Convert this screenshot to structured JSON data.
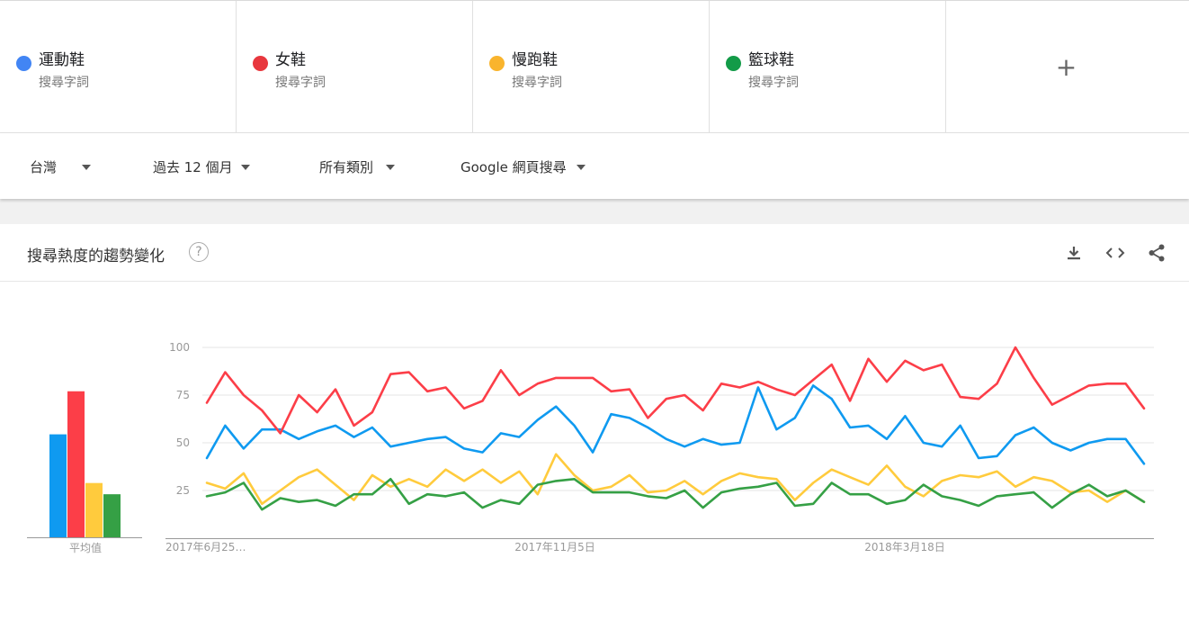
{
  "terms": [
    {
      "name": "運動鞋",
      "sub": "搜尋字詞",
      "color": "#4285f4"
    },
    {
      "name": "女鞋",
      "sub": "搜尋字詞",
      "color": "#e8373e"
    },
    {
      "name": "慢跑鞋",
      "sub": "搜尋字詞",
      "color": "#f9b42d"
    },
    {
      "name": "籃球鞋",
      "sub": "搜尋字詞",
      "color": "#139b48"
    }
  ],
  "add_label": "+",
  "filters": {
    "region": "台灣",
    "time": "過去 12 個月",
    "category": "所有類別",
    "search_type": "Google 網頁搜尋"
  },
  "card": {
    "title": "搜尋熱度的趨勢變化",
    "help": "?"
  },
  "chart_data": [
    {
      "type": "bar",
      "categories": [
        "運動鞋",
        "女鞋",
        "慢跑鞋",
        "籃球鞋"
      ],
      "values": [
        55,
        78,
        29,
        23
      ],
      "colors": [
        "#0f9af0",
        "#fc3e48",
        "#ffcb3d",
        "#35a045"
      ],
      "xlabel": "平均值",
      "ylim": [
        0,
        100
      ]
    },
    {
      "type": "line",
      "x_tick_labels": [
        "2017年6月25…",
        "2017年11月5日",
        "2018年3月18日"
      ],
      "y_ticks": [
        25,
        50,
        75,
        100
      ],
      "ylim": [
        0,
        100
      ],
      "grid": true,
      "series": [
        {
          "name": "運動鞋",
          "color": "#0f9af0",
          "values": [
            42,
            59,
            47,
            57,
            57,
            52,
            56,
            59,
            53,
            58,
            48,
            50,
            52,
            53,
            47,
            45,
            55,
            53,
            62,
            69,
            59,
            45,
            65,
            63,
            58,
            52,
            48,
            52,
            49,
            50,
            79,
            57,
            63,
            80,
            73,
            58,
            59,
            52,
            64,
            50,
            48,
            59,
            42,
            43,
            54,
            58,
            50,
            46,
            50,
            52,
            52,
            39
          ]
        },
        {
          "name": "女鞋",
          "color": "#fc3e48",
          "values": [
            71,
            87,
            75,
            67,
            55,
            75,
            66,
            78,
            59,
            66,
            86,
            87,
            77,
            79,
            68,
            72,
            88,
            75,
            81,
            84,
            84,
            84,
            77,
            78,
            63,
            73,
            75,
            67,
            81,
            79,
            82,
            78,
            75,
            83,
            91,
            72,
            94,
            82,
            93,
            88,
            91,
            74,
            73,
            81,
            100,
            84,
            70,
            75,
            80,
            81,
            81,
            68
          ]
        },
        {
          "name": "慢跑鞋",
          "color": "#ffcb3d",
          "values": [
            29,
            26,
            34,
            18,
            25,
            32,
            36,
            28,
            20,
            33,
            27,
            31,
            27,
            36,
            30,
            36,
            29,
            35,
            23,
            44,
            33,
            25,
            27,
            33,
            24,
            25,
            30,
            23,
            30,
            34,
            32,
            31,
            20,
            29,
            36,
            32,
            28,
            38,
            27,
            22,
            30,
            33,
            32,
            35,
            27,
            32,
            30,
            24,
            25,
            19,
            25,
            19
          ]
        },
        {
          "name": "籃球鞋",
          "color": "#35a045",
          "values": [
            22,
            24,
            29,
            15,
            21,
            19,
            20,
            17,
            23,
            23,
            31,
            18,
            23,
            22,
            24,
            16,
            20,
            18,
            28,
            30,
            31,
            24,
            24,
            24,
            22,
            21,
            25,
            16,
            24,
            26,
            27,
            29,
            17,
            18,
            29,
            23,
            23,
            18,
            20,
            28,
            22,
            20,
            17,
            22,
            23,
            24,
            16,
            23,
            28,
            22,
            25,
            19
          ]
        }
      ]
    }
  ]
}
